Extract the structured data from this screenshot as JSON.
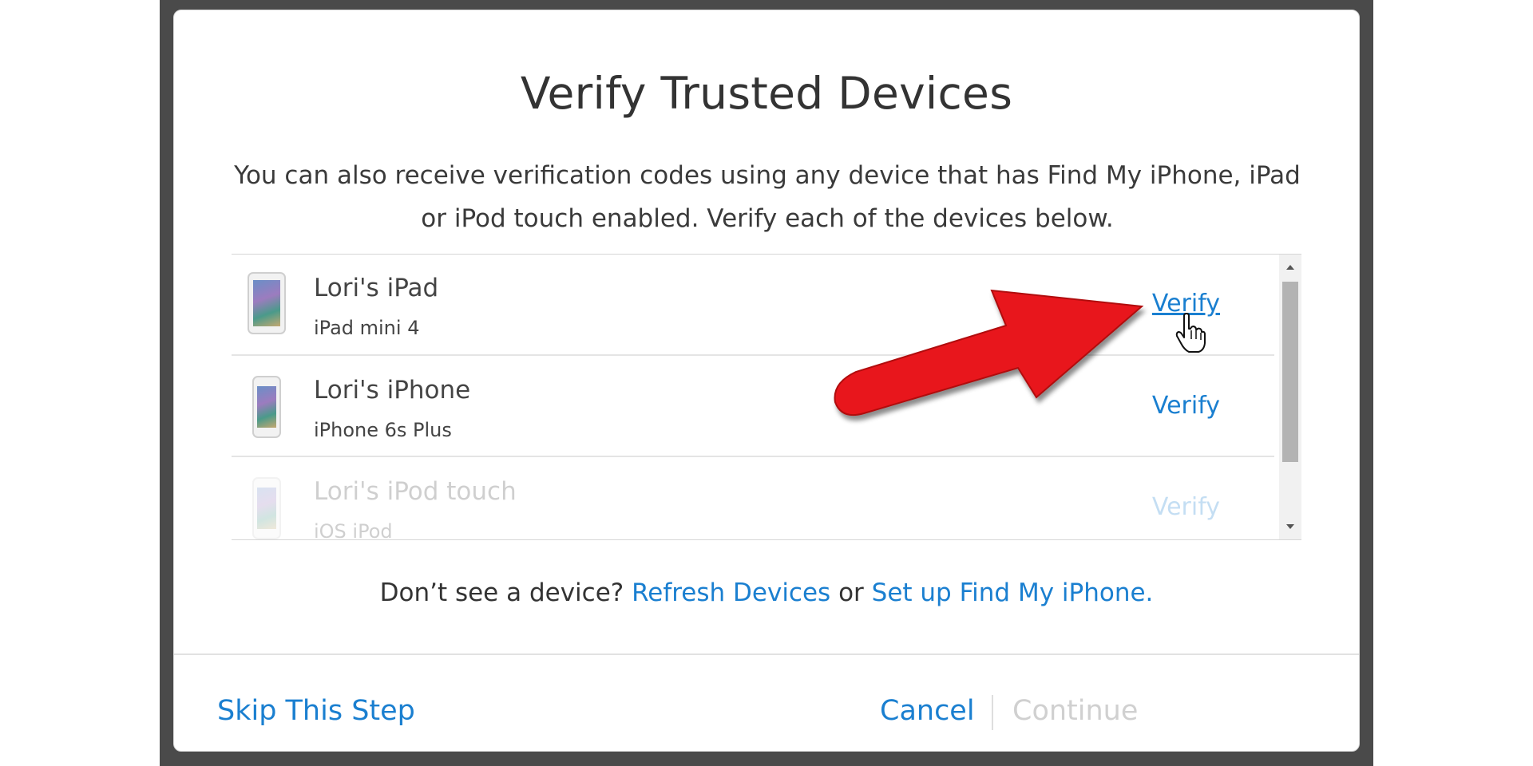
{
  "dialog": {
    "title": "Verify Trusted Devices",
    "subtitle_line1": "You can also receive verification codes using any device that has Find My iPhone, iPad",
    "subtitle_line2": "or iPod touch enabled. Verify each of the devices below."
  },
  "devices": [
    {
      "name": "Lori's iPad",
      "model": "iPad mini 4",
      "action": "Verify",
      "icon": "ipad-icon"
    },
    {
      "name": "Lori's iPhone",
      "model": "iPhone 6s Plus",
      "action": "Verify",
      "icon": "iphone-icon"
    },
    {
      "name": "Lori's iPod touch",
      "model": "iOS iPod",
      "action": "Verify",
      "icon": "ipod-icon"
    }
  ],
  "footer_note": {
    "prefix": "Don’t see a device?",
    "refresh_link": "Refresh Devices",
    "middle": "or",
    "setup_link": "Set up Find My iPhone."
  },
  "actions": {
    "skip": "Skip This Step",
    "cancel": "Cancel",
    "continue": "Continue"
  },
  "colors": {
    "link": "#1a7fd0",
    "annotation_arrow": "#e8141a",
    "disabled": "#d0d0d0"
  }
}
